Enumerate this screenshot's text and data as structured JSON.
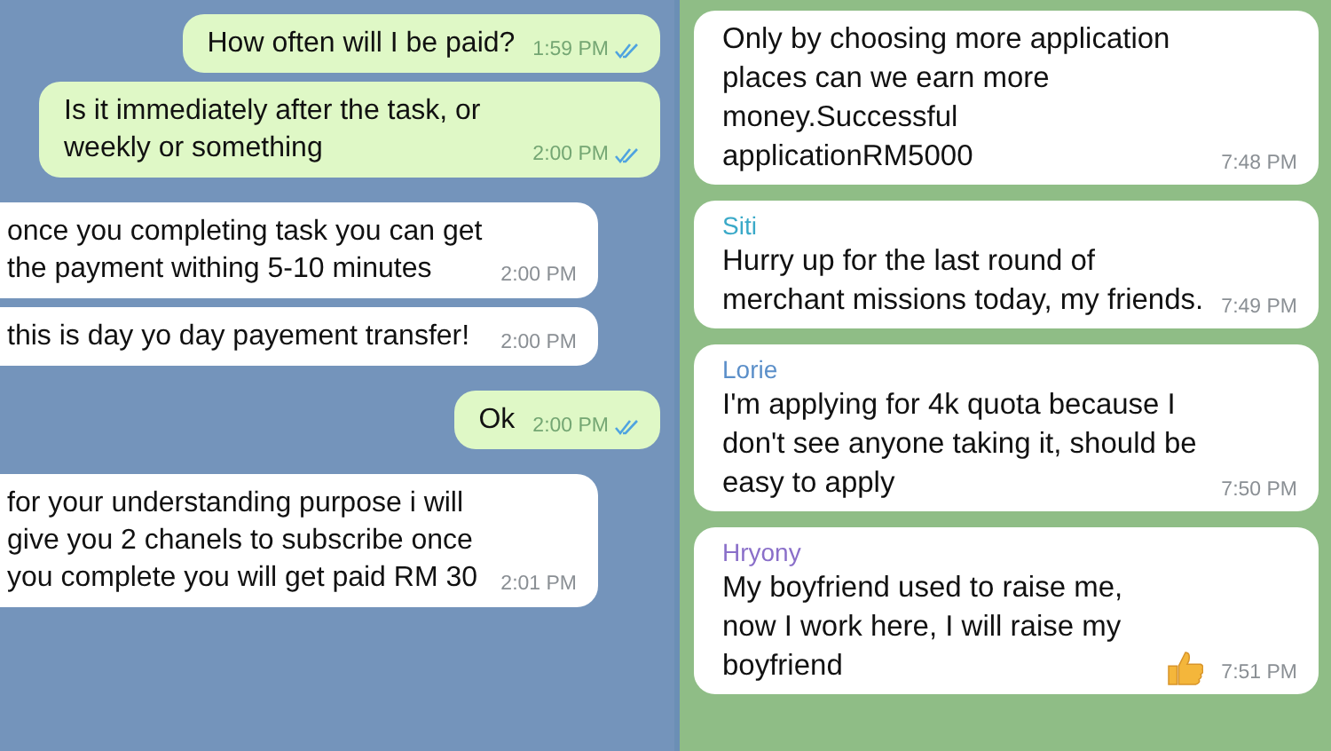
{
  "panels": [
    {
      "kind": "sky",
      "messages": [
        {
          "kind": "out",
          "text": "How often will I be paid?",
          "time": "1:59 PM",
          "read": true
        },
        {
          "kind": "out",
          "text": "Is it immediately after the task, or weekly or something",
          "time": "2:00 PM",
          "read": true
        },
        {
          "kind": "in",
          "text": "once you completing task you can get the payment withing 5-10 minutes",
          "time": "2:00 PM"
        },
        {
          "kind": "in",
          "text": "this is day yo day payement transfer!",
          "time": "2:00 PM"
        },
        {
          "kind": "out",
          "text": "Ok",
          "time": "2:00 PM",
          "read": true
        },
        {
          "kind": "in",
          "text": "for your understanding purpose i will give you 2 chanels to subscribe once you complete you will get paid RM 30",
          "time": "2:01 PM"
        }
      ]
    },
    {
      "kind": "doodle",
      "messages": [
        {
          "kind": "in",
          "text": "Only by choosing more application places can we earn more money.Successful applicationRM5000",
          "time": "7:48 PM"
        },
        {
          "kind": "in",
          "sender": "Siti",
          "color": "#3aa9c8",
          "text": "Hurry up for the last round of merchant missions today, my friends.",
          "time": "7:49 PM"
        },
        {
          "kind": "in",
          "sender": "Lorie",
          "color": "#5b8fc9",
          "text": "I'm applying for 4k quota because I don't see anyone taking it, should be easy to apply",
          "time": "7:50 PM"
        },
        {
          "kind": "in",
          "sender": "Hryony",
          "color": "#8a6fc9",
          "text": "My boyfriend used to raise me, now I work here, I will raise my boyfriend",
          "thumbs_up": true,
          "time": "7:51 PM"
        }
      ]
    }
  ]
}
